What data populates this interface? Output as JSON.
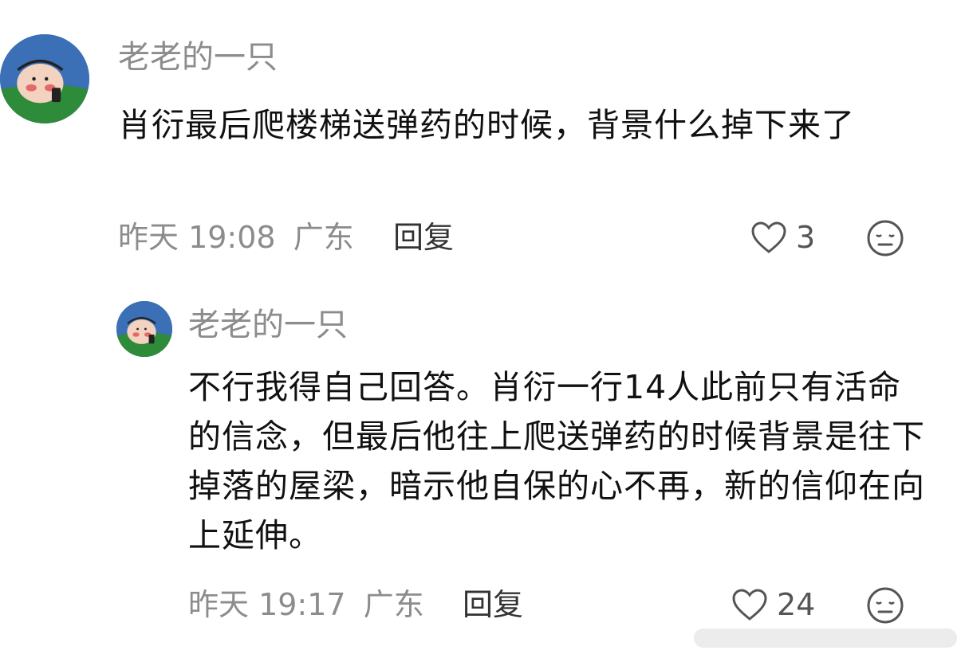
{
  "comments": [
    {
      "username": "老老的一只",
      "text": "肖衍最后爬楼梯送弹药的时候，背景什么掉下来了",
      "time": "昨天 19:08",
      "location": "广东",
      "reply_label": "回复",
      "likes": "3",
      "like_icon": "heart-outline-icon",
      "emoji_icon": "neutral-face-icon"
    },
    {
      "username": "老老的一只",
      "text": "不行我得自己回答。肖衍一行14人此前只有活命的信念，但最后他往上爬送弹药的时候背景是往下掉落的屋梁，暗示他自保的心不再，新的信仰在向上延伸。",
      "time": "昨天 19:17",
      "location": "广东",
      "reply_label": "回复",
      "likes": "24",
      "like_icon": "heart-outline-icon",
      "emoji_icon": "neutral-face-icon"
    }
  ],
  "colors": {
    "username": "#8c8c8c",
    "meta": "#8c8c8c",
    "text": "#111111",
    "reply": "#333333",
    "avatar_bg": "#3b6fb6",
    "avatar_grass": "#2e8b3a"
  }
}
